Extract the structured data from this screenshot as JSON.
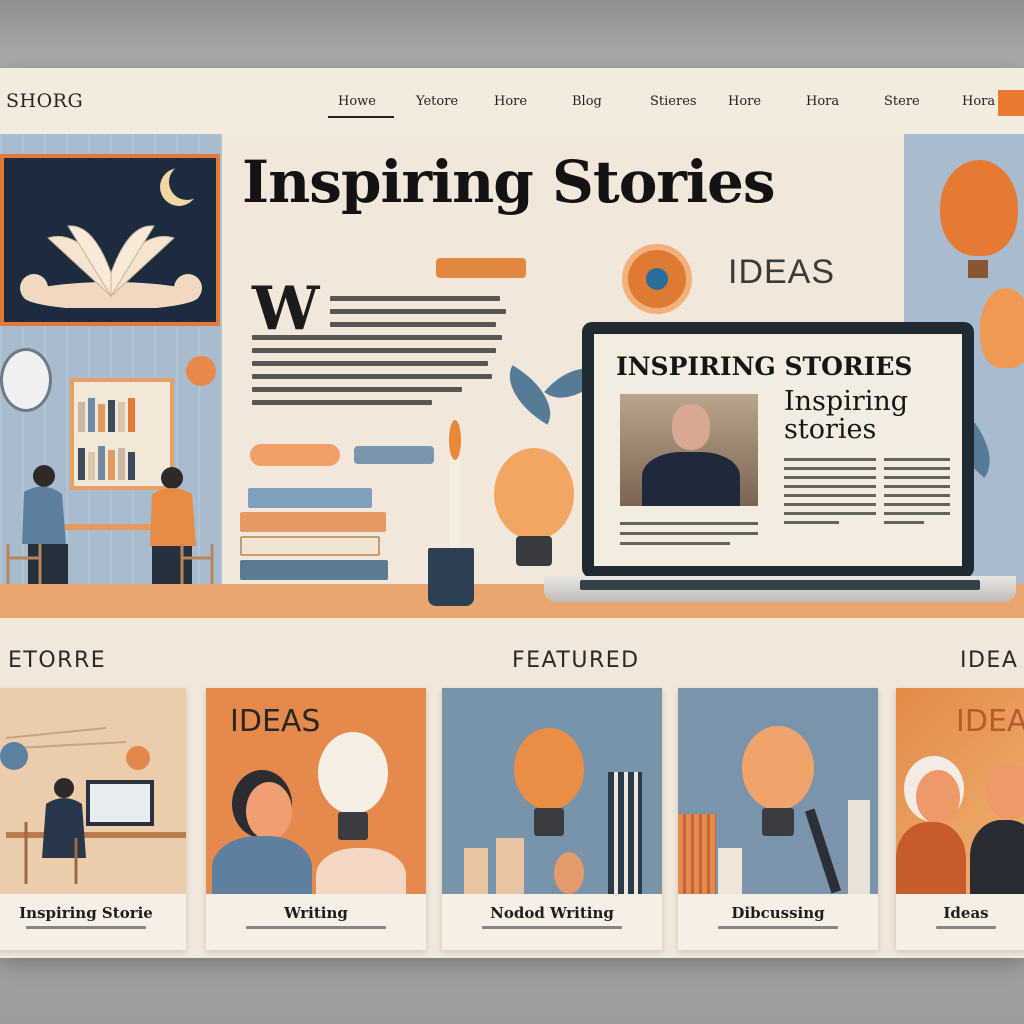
{
  "brand": {
    "logo": "SHORG"
  },
  "nav": {
    "items": [
      "Howe",
      "Yetore",
      "Hore",
      "Blog",
      "Stieres",
      "Hore",
      "Hora",
      "Stere",
      "Hora"
    ],
    "active_index": 0
  },
  "hero": {
    "title": "Inspiring Stories",
    "drop_cap": "W",
    "ideas_label": "IDEAS"
  },
  "laptop": {
    "title": "INSPIRING STORIES",
    "subtitle": "Inspiring stories"
  },
  "sections": {
    "left": "ETORRE",
    "center": "FEATURED",
    "right": "IDEA"
  },
  "cards": [
    {
      "title": "Inspiring Storie",
      "art": "person-at-computer"
    },
    {
      "title": "Writing",
      "art_label": "IDEAS",
      "art": "person-with-bulb"
    },
    {
      "title": "Nodod Writing",
      "art": "glowing-bulb-city"
    },
    {
      "title": "Dibcussing",
      "art": "glowing-bulb-pen"
    },
    {
      "title": "Ideas",
      "art_label": "IDEAS",
      "art": "two-people-talking"
    }
  ],
  "colors": {
    "accent_orange": "#e77a2e",
    "slate_blue": "#a9bccd",
    "navy": "#1d2b3e",
    "paper": "#f1e7da"
  }
}
